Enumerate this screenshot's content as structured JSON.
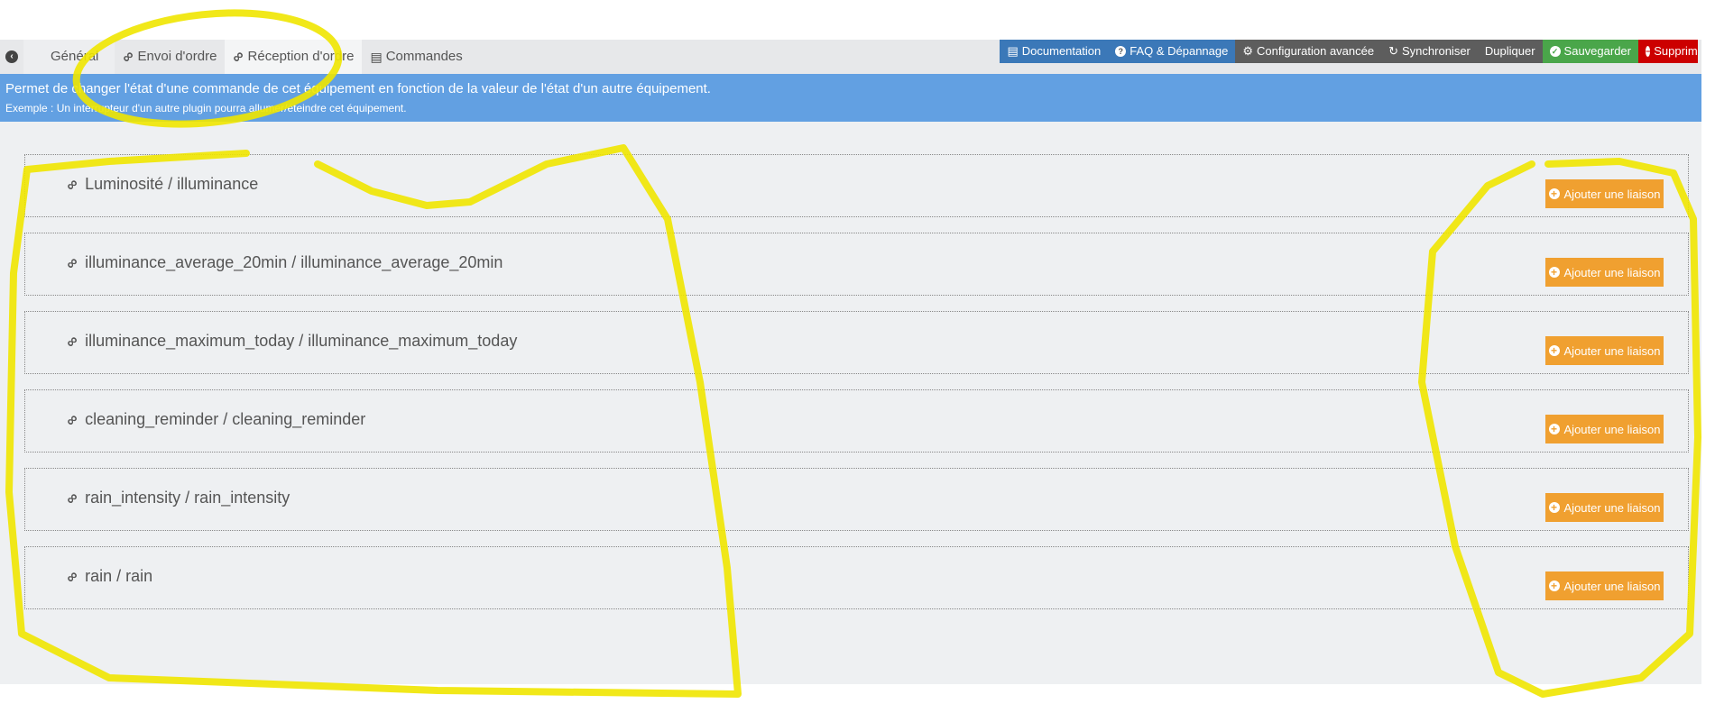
{
  "tabs": [
    {
      "label": "Général",
      "icon": "none"
    },
    {
      "label": "Envoi d'ordre",
      "icon": "link-icon"
    },
    {
      "label": "Réception d'ordre",
      "icon": "link-icon"
    },
    {
      "label": "Commandes",
      "icon": "list-icon"
    }
  ],
  "actions": {
    "documentation": "Documentation",
    "faq": "FAQ & Dépannage",
    "config": "Configuration avancée",
    "sync": "Synchroniser",
    "duplicate": "Dupliquer",
    "save": "Sauvegarder",
    "delete": "Supprimer"
  },
  "banner": {
    "line1": "Permet de changer l'état d'une commande de cet équipement en fonction de la valeur de l'état d'un autre équipement.",
    "line2": "Exemple : Un interrupteur d'un autre plugin pourra allumer/éteindre cet équipement."
  },
  "commands": [
    {
      "title": "Luminosité / illuminance"
    },
    {
      "title": "illuminance_average_20min / illuminance_average_20min"
    },
    {
      "title": "illuminance_maximum_today / illuminance_maximum_today"
    },
    {
      "title": "cleaning_reminder / cleaning_reminder"
    },
    {
      "title": "rain_intensity / rain_intensity"
    },
    {
      "title": "rain / rain"
    }
  ],
  "add_link_label": "Ajouter une liaison",
  "colors": {
    "banner": "#62a0e2",
    "add": "#f0a030",
    "annotation": "#f0e600"
  }
}
